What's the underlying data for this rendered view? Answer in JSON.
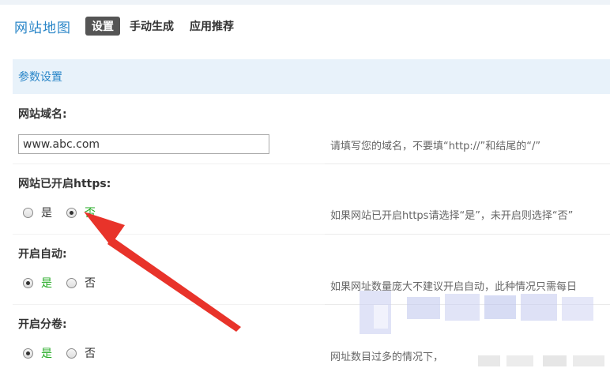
{
  "nav": {
    "title": "网站地图",
    "tabs": [
      {
        "label": "设置",
        "active": true
      },
      {
        "label": "手动生成",
        "active": false
      },
      {
        "label": "应用推荐",
        "active": false
      }
    ]
  },
  "section": {
    "title": "参数设置"
  },
  "fields": {
    "domain": {
      "label": "网站域名:",
      "value": "www.abc.com",
      "hint": "请填写您的域名，不要填“http://”和结尾的“/”"
    },
    "https": {
      "label": "网站已开启https:",
      "options": [
        "是",
        "否"
      ],
      "selected": "否",
      "hint": "如果网站已开启https请选择“是”，未开启则选择“否”"
    },
    "auto": {
      "label": "开启自动:",
      "options": [
        "是",
        "否"
      ],
      "selected": "是",
      "hint": "如果网址数量庞大不建议开启自动，此种情况只需每日"
    },
    "split": {
      "label": "开启分卷:",
      "options": [
        "是",
        "否"
      ],
      "selected": "是",
      "hint": "网址数目过多的情况下，"
    }
  },
  "colors": {
    "accent": "#2a86c8",
    "section_bg": "#e8f2fa",
    "active_tab_bg": "#555555",
    "selected_option": "#22aa22",
    "arrow": "#e8332a"
  }
}
